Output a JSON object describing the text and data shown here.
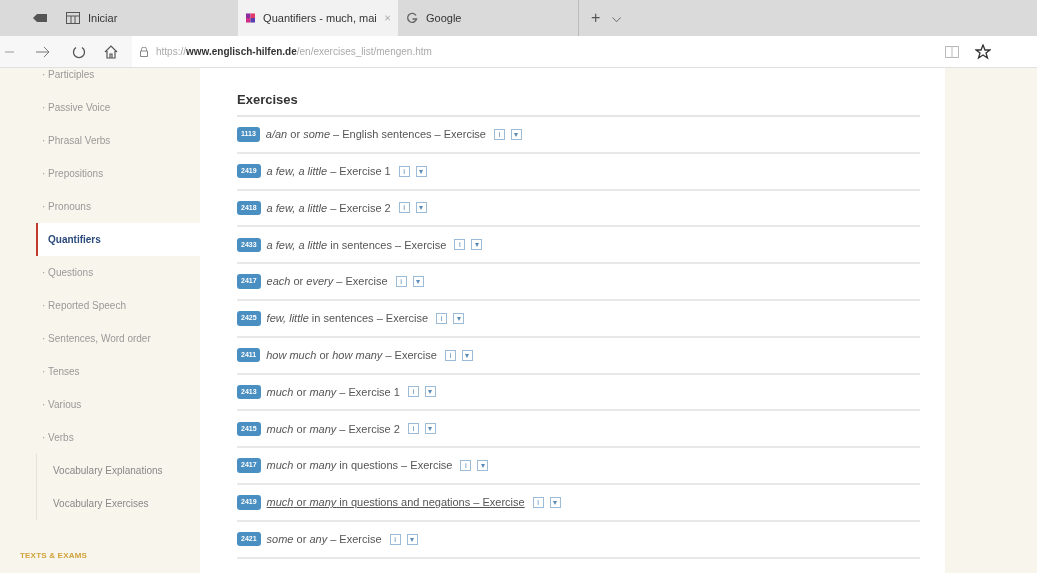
{
  "browser": {
    "tabs": [
      {
        "label": "Iniciar",
        "kind": "pinned",
        "selected": false
      },
      {
        "label": "Quantifiers - much, mai",
        "kind": "page",
        "selected": true
      },
      {
        "label": "Google",
        "kind": "google",
        "selected": false
      }
    ],
    "new_tab": "+",
    "tab_menu": "⌵",
    "address": "https://**www.englisch-hilfen.de**/en/exercises_list/mengen.htm"
  },
  "sidebar": {
    "items": [
      {
        "label": "· Participles",
        "kind": "sub",
        "selected": false
      },
      {
        "label": "· Passive Voice",
        "kind": "sub",
        "selected": false
      },
      {
        "label": "· Phrasal Verbs",
        "kind": "sub",
        "selected": false
      },
      {
        "label": "· Prepositions",
        "kind": "sub",
        "selected": false
      },
      {
        "label": "· Pronouns",
        "kind": "sub",
        "selected": false
      },
      {
        "label": "Quantifiers",
        "kind": "sub",
        "selected": true
      },
      {
        "label": "· Questions",
        "kind": "sub",
        "selected": false
      },
      {
        "label": "· Reported Speech",
        "kind": "sub",
        "selected": false
      },
      {
        "label": "· Sentences, Word order",
        "kind": "sub",
        "selected": false
      },
      {
        "label": "· Tenses",
        "kind": "sub",
        "selected": false
      },
      {
        "label": "· Various",
        "kind": "sub",
        "selected": false
      },
      {
        "label": "· Verbs",
        "kind": "sub",
        "selected": false
      },
      {
        "label": "Vocabulary Explanations",
        "kind": "top",
        "selected": false
      },
      {
        "label": "Vocabulary Exercises",
        "kind": "top",
        "selected": false
      }
    ],
    "section": "TEXTS & EXAMS"
  },
  "exercises": {
    "title": "Exercises",
    "rows": [
      {
        "number": "1113",
        "title": "*a/an* or *some* – English sentences – Exercise",
        "info": "i",
        "more": "▾",
        "underlined": false
      },
      {
        "number": "2419",
        "title": "*a few, a little* – Exercise 1",
        "info": "i",
        "more": "▾",
        "underlined": false
      },
      {
        "number": "2418",
        "title": "*a few, a little* – Exercise 2",
        "info": "i",
        "more": "▾",
        "underlined": false
      },
      {
        "number": "2433",
        "title": "*a few, a little* in sentences – Exercise",
        "info": "i",
        "more": "▾",
        "underlined": false
      },
      {
        "number": "2417",
        "title": "*each* or *every* – Exercise",
        "info": "i",
        "more": "▾",
        "underlined": false
      },
      {
        "number": "2425",
        "title": "*few, little* in sentences – Exercise",
        "info": "i",
        "more": "▾",
        "underlined": false
      },
      {
        "number": "2411",
        "title": "*how much* or *how many* – Exercise",
        "info": "i",
        "more": "▾",
        "underlined": false
      },
      {
        "number": "2413",
        "title": "*much* or *many* – Exercise 1",
        "info": "i",
        "more": "▾",
        "underlined": false
      },
      {
        "number": "2415",
        "title": "*much* or *many* – Exercise 2",
        "info": "i",
        "more": "▾",
        "underlined": false
      },
      {
        "number": "2417",
        "title": "*much* or *many* in questions – Exercise",
        "info": "i",
        "more": "▾",
        "underlined": false
      },
      {
        "number": "2419",
        "title": "*much* or *many* in questions and negations – Exercise",
        "info": "i",
        "more": "▾",
        "underlined": true
      },
      {
        "number": "2421",
        "title": "*some* or *any* – Exercise",
        "info": "i",
        "more": "▾",
        "underlined": false
      }
    ]
  }
}
